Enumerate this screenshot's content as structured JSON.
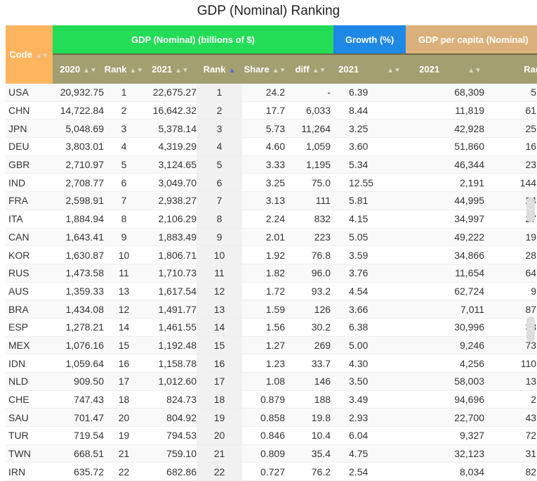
{
  "title": "GDP (Nominal) Ranking",
  "header": {
    "code": "Code",
    "group_gdp": "GDP (Nominal) (billions of $)",
    "group_growth": "Growth (%)",
    "group_percapita": "GDP per capita (Nominal)",
    "cols": [
      "2020",
      "Rank",
      "2021",
      "Rank",
      "Share",
      "diff",
      "2021",
      "2021",
      "Rank"
    ]
  },
  "colors": {
    "code": "#fcb55e",
    "gdp": "#22dd55",
    "growth": "#1e88e5",
    "percapita": "#dcb07a",
    "subheader": "#a39f71"
  },
  "rows": [
    [
      "USA",
      "20,932.75",
      "1",
      "22,675.27",
      "1",
      "24.2",
      "-",
      "6.39",
      "68,309",
      "5"
    ],
    [
      "CHN",
      "14,722.84",
      "2",
      "16,642.32",
      "2",
      "17.7",
      "6,033",
      "8.44",
      "11,819",
      "61"
    ],
    [
      "JPN",
      "5,048.69",
      "3",
      "5,378.14",
      "3",
      "5.73",
      "11,264",
      "3.25",
      "42,928",
      "25"
    ],
    [
      "DEU",
      "3,803.01",
      "4",
      "4,319.29",
      "4",
      "4.60",
      "1,059",
      "3.60",
      "51,860",
      "16"
    ],
    [
      "GBR",
      "2,710.97",
      "5",
      "3,124.65",
      "5",
      "3.33",
      "1,195",
      "5.34",
      "46,344",
      "23"
    ],
    [
      "IND",
      "2,708.77",
      "6",
      "3,049.70",
      "6",
      "3.25",
      "75.0",
      "12.55",
      "2,191",
      "144"
    ],
    [
      "FRA",
      "2,598.91",
      "7",
      "2,938.27",
      "7",
      "3.13",
      "111",
      "5.81",
      "44,995",
      "24"
    ],
    [
      "ITA",
      "1,884.94",
      "8",
      "2,106.29",
      "8",
      "2.24",
      "832",
      "4.15",
      "34,997",
      "27"
    ],
    [
      "CAN",
      "1,643.41",
      "9",
      "1,883.49",
      "9",
      "2.01",
      "223",
      "5.05",
      "49,222",
      "19"
    ],
    [
      "KOR",
      "1,630.87",
      "10",
      "1,806.71",
      "10",
      "1.92",
      "76.8",
      "3.59",
      "34,866",
      "28"
    ],
    [
      "RUS",
      "1,473.58",
      "11",
      "1,710.73",
      "11",
      "1.82",
      "96.0",
      "3.76",
      "11,654",
      "64"
    ],
    [
      "AUS",
      "1,359.33",
      "13",
      "1,617.54",
      "12",
      "1.72",
      "93.2",
      "4.54",
      "62,724",
      "9"
    ],
    [
      "BRA",
      "1,434.08",
      "12",
      "1,491.77",
      "13",
      "1.59",
      "126",
      "3.66",
      "7,011",
      "87"
    ],
    [
      "ESP",
      "1,278.21",
      "14",
      "1,461.55",
      "14",
      "1.56",
      "30.2",
      "6.38",
      "30,996",
      "33"
    ],
    [
      "MEX",
      "1,076.16",
      "15",
      "1,192.48",
      "15",
      "1.27",
      "269",
      "5.00",
      "9,246",
      "73"
    ],
    [
      "IDN",
      "1,059.64",
      "16",
      "1,158.78",
      "16",
      "1.23",
      "33.7",
      "4.30",
      "4,256",
      "110"
    ],
    [
      "NLD",
      "909.50",
      "17",
      "1,012.60",
      "17",
      "1.08",
      "146",
      "3.50",
      "58,003",
      "13"
    ],
    [
      "CHE",
      "747.43",
      "18",
      "824.73",
      "18",
      "0.879",
      "188",
      "3.49",
      "94,696",
      "2"
    ],
    [
      "SAU",
      "701.47",
      "20",
      "804.92",
      "19",
      "0.858",
      "19.8",
      "2.93",
      "22,700",
      "43"
    ],
    [
      "TUR",
      "719.54",
      "19",
      "794.53",
      "20",
      "0.846",
      "10.4",
      "6.04",
      "9,327",
      "72"
    ],
    [
      "TWN",
      "668.51",
      "21",
      "759.10",
      "21",
      "0.809",
      "35.4",
      "4.75",
      "32,123",
      "31"
    ],
    [
      "IRN",
      "635.72",
      "22",
      "682.86",
      "22",
      "0.727",
      "76.2",
      "2.54",
      "8,034",
      "82"
    ]
  ]
}
